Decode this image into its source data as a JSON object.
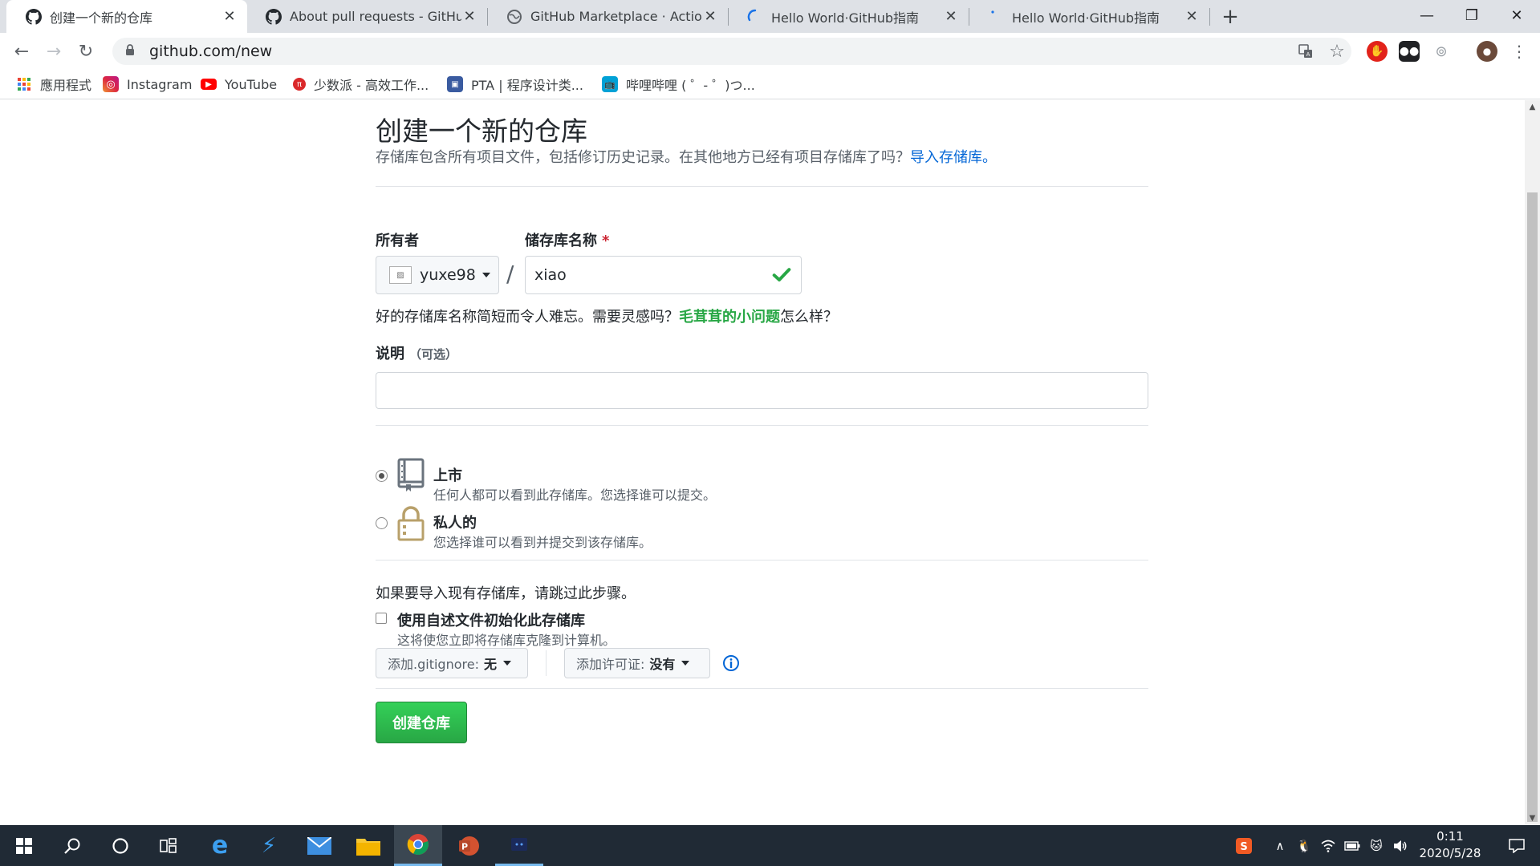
{
  "browser": {
    "tabs": [
      {
        "title": "创建一个新的仓库",
        "active": true
      },
      {
        "title": "About pull requests - GitHub H",
        "active": false
      },
      {
        "title": "GitHub Marketplace · Actions t",
        "active": false
      },
      {
        "title": "Hello World·GitHub指南",
        "active": false
      },
      {
        "title": "Hello World·GitHub指南",
        "active": false
      }
    ],
    "url": "github.com/new",
    "bookmarks": [
      {
        "label": "應用程式"
      },
      {
        "label": "Instagram"
      },
      {
        "label": "YouTube"
      },
      {
        "label": "少数派 - 高效工作..."
      },
      {
        "label": "PTA | 程序设计类..."
      },
      {
        "label": "哔哩哔哩 ( ゜- ゜)つ..."
      }
    ]
  },
  "page": {
    "title": "创建一个新的仓库",
    "subtitle": "存储库包含所有项目文件，包括修订历史记录。在其他地方已经有项目存储库了吗？",
    "import_link": "导入存储库。",
    "owner_label": "所有者",
    "repo_name_label": "储存库名称",
    "required_mark": "*",
    "owner_value": "yuxe98",
    "repo_name_value": "xiao",
    "hint_prefix": "好的存储库名称简短而令人难忘。需要灵感吗？",
    "hint_suggestion": "毛茸茸的小问题",
    "hint_suffix": "怎么样？",
    "description_label": "说明",
    "description_optional": "（可选）",
    "description_value": "",
    "visibility": {
      "public_title": "上市",
      "public_note": "任何人都可以看到此存储库。您选择谁可以提交。",
      "private_title": "私人的",
      "private_note": "您选择谁可以看到并提交到该存储库。",
      "selected": "public"
    },
    "skip_text": "如果要导入现有存储库，请跳过此步骤。",
    "init_readme_title": "使用自述文件初始化此存储库",
    "init_readme_note": "这将使您立即将存储库克隆到计算机。",
    "gitignore_label": "添加.gitignore:",
    "gitignore_value": "无",
    "license_label": "添加许可证:",
    "license_value": "没有",
    "create_button": "创建仓库"
  },
  "taskbar": {
    "time": "0:11",
    "date": "2020/5/28"
  },
  "colors": {
    "link": "#0366d6",
    "success": "#28a745",
    "required": "#cb2431",
    "taskbar": "#202a35"
  }
}
